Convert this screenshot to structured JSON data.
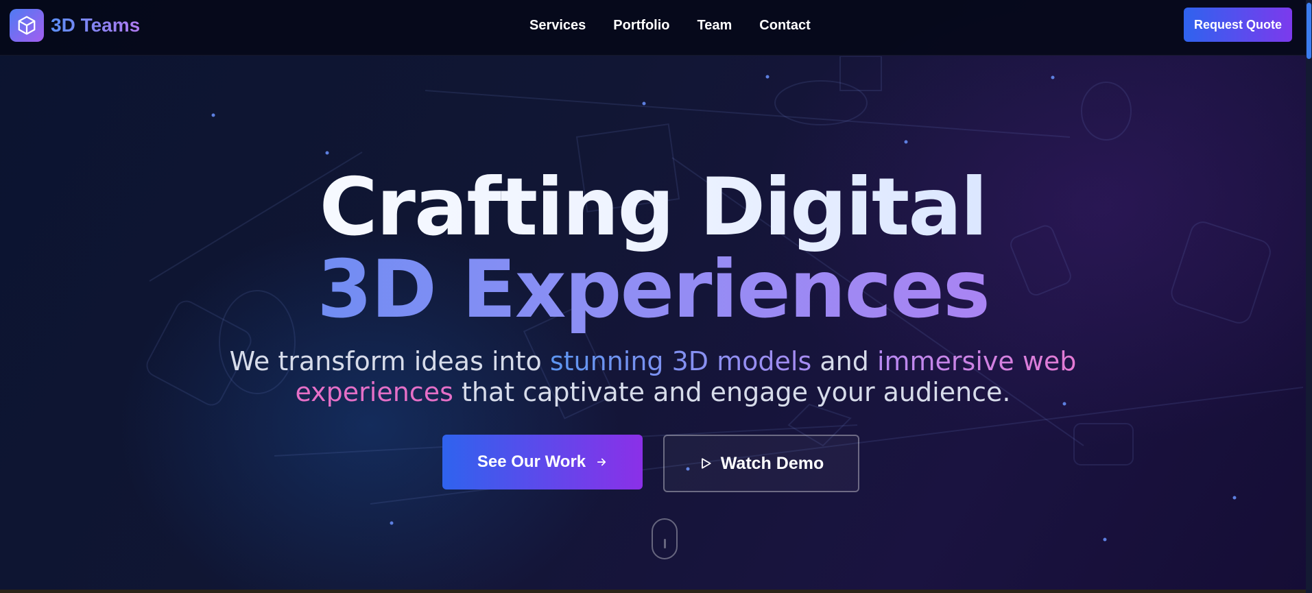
{
  "nav": {
    "logo_icon": "cube-icon",
    "logo_text": "3D Teams",
    "links": [
      "Services",
      "Portfolio",
      "Team",
      "Contact"
    ],
    "cta_label": "Request Quote"
  },
  "hero": {
    "title_line1": "Crafting Digital",
    "title_line2": "3D Experiences",
    "subtitle": {
      "part1": "We transform ideas into ",
      "highlight1": "stunning 3D models",
      "part2": " and ",
      "highlight2": "immersive web",
      "highlight3": "experiences",
      "part3": " that captivate and engage your audience."
    },
    "primary_button": {
      "label": "See Our Work",
      "icon": "arrow-right-icon"
    },
    "secondary_button": {
      "label": "Watch Demo",
      "icon": "play-icon"
    },
    "scroll_icon": "mouse-scroll-icon"
  },
  "colors": {
    "brand_blue": "#2f63ee",
    "brand_purple": "#8b30e8",
    "pink_accent": "#e56fc7"
  }
}
